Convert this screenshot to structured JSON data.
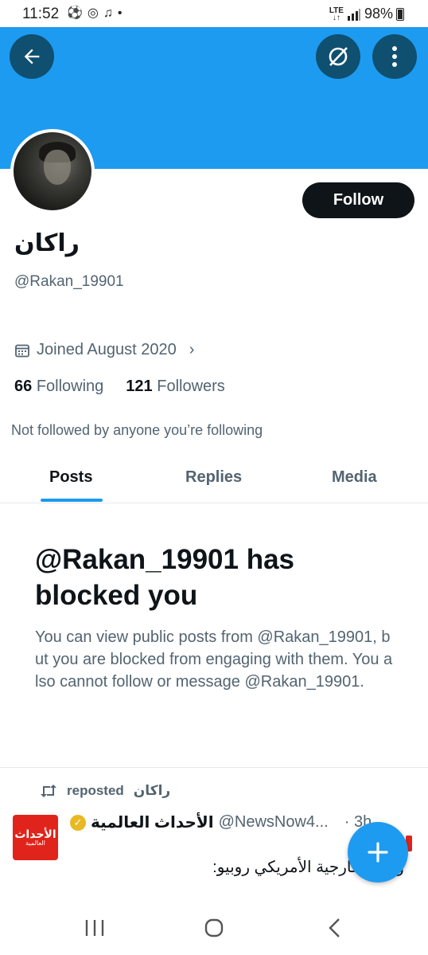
{
  "status_bar": {
    "time": "11:52",
    "network": "LTE",
    "battery": "98%"
  },
  "profile": {
    "display_name": "راكان",
    "handle": "@Rakan_19901",
    "joined": "Joined August 2020",
    "following_count": "66",
    "following_label": "Following",
    "followers_count": "121",
    "followers_label": "Followers",
    "not_followed_text": "Not followed by anyone you’re following",
    "follow_label": "Follow"
  },
  "tabs": [
    {
      "label": "Posts",
      "active": true
    },
    {
      "label": "Replies",
      "active": false
    },
    {
      "label": "Media",
      "active": false
    }
  ],
  "blocked": {
    "title": "@Rakan_19901 has blocked you",
    "body": "You can view public posts from @Rakan_19901, but you are blocked from engaging with them. You also cannot follow or message @Rakan_19901."
  },
  "post": {
    "repost_label": "reposted",
    "repost_by": "راكان",
    "author_name": "الأحداث العالمية",
    "author_handle": "@NewsNow4...",
    "time": "· 3h",
    "text": "وزير الخارجية الأمريكي روبيو:",
    "avatar_text_1": "الأحداث",
    "avatar_text_2": "العالمية"
  },
  "colors": {
    "accent": "#1d9bf0",
    "banner": "#1d9bf0",
    "button_dark": "#0f1419",
    "secondary_text": "#536471",
    "avatar_red": "#e0241b"
  }
}
